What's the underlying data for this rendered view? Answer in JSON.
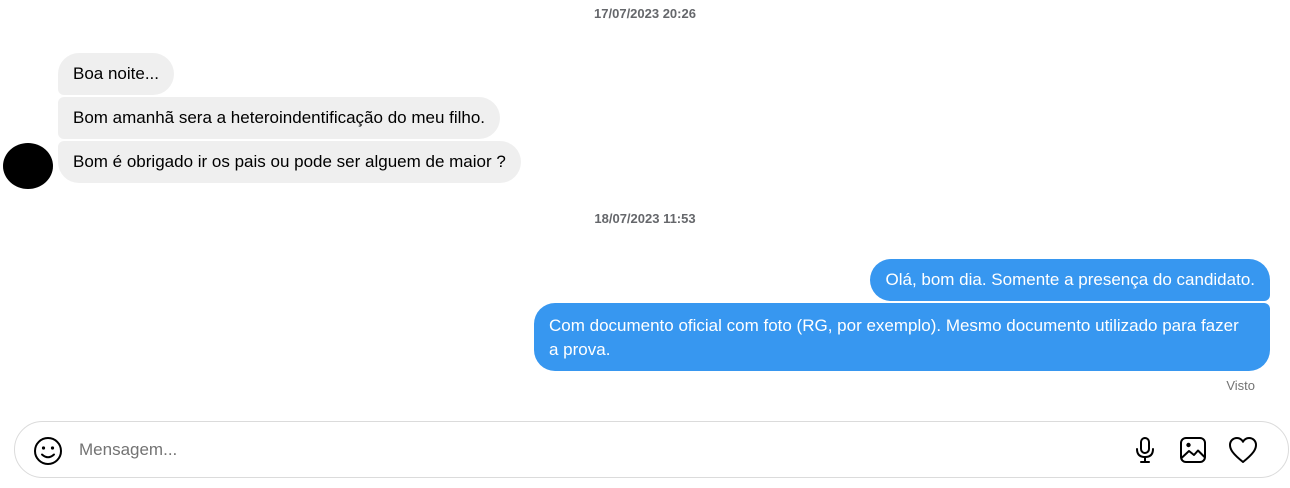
{
  "conversation": {
    "timestamps": [
      "17/07/2023 20:26",
      "18/07/2023 11:53"
    ],
    "incoming": [
      "Boa noite...",
      "Bom amanhã sera a heteroindentificação do meu filho.",
      "Bom é obrigado ir os pais ou pode ser alguem de maior ?"
    ],
    "outgoing": [
      "Olá, bom dia. Somente a presença do candidato.",
      "Com documento oficial com foto (RG, por exemplo). Mesmo documento utilizado para fazer a prova."
    ],
    "seen_status": "Visto"
  },
  "composer": {
    "placeholder": "Mensagem...",
    "value": "",
    "icons": [
      "emoji-icon",
      "microphone-icon",
      "image-icon",
      "heart-icon"
    ]
  },
  "colors": {
    "outgoing_bubble": "#3797f0",
    "incoming_bubble": "#efefef",
    "timestamp_text": "#65676b"
  }
}
